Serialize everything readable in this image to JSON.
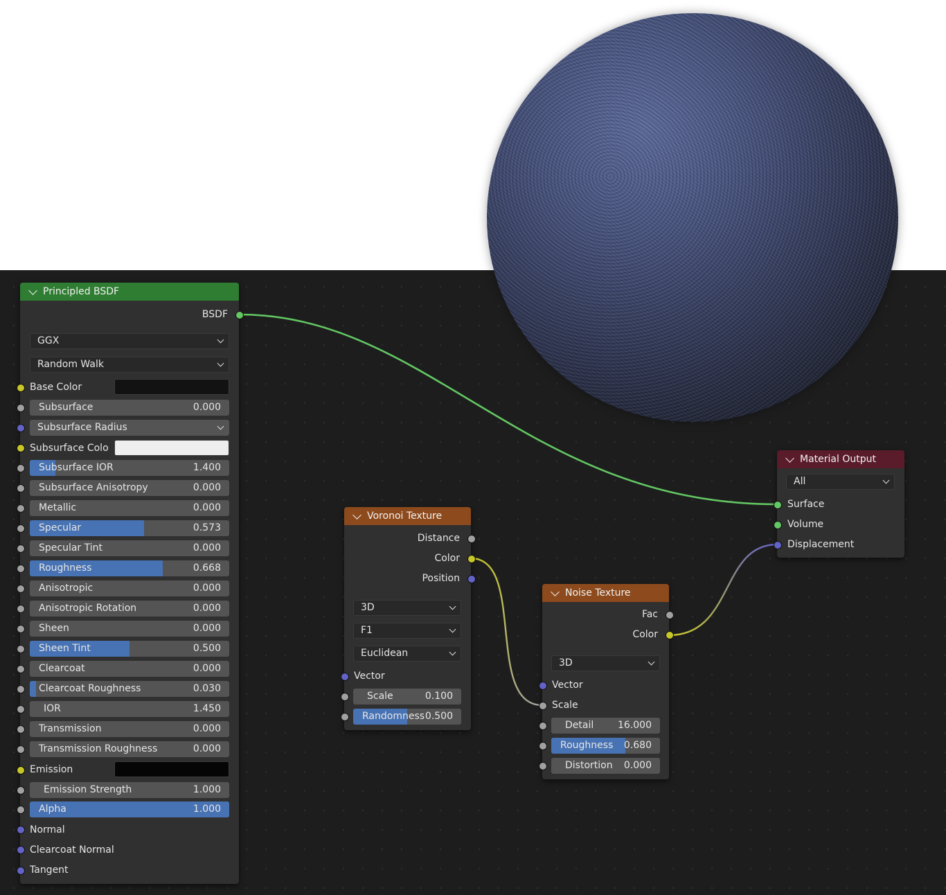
{
  "principled": {
    "title": "Principled BSDF",
    "header_color": "#2f7d32",
    "output": "BSDF",
    "distribution": "GGX",
    "subsurface_method": "Random Walk",
    "base_color": {
      "label": "Base Color",
      "swatch": "#121212"
    },
    "subsurface": {
      "label": "Subsurface",
      "value": "0.000",
      "fill": 0
    },
    "subsurface_radius": "Subsurface Radius",
    "subsurface_color": {
      "label": "Subsurface Colo",
      "swatch": "#eeeeee"
    },
    "subsurface_ior": {
      "label": "Subsurface IOR",
      "value": "1.400",
      "fill": 0.13
    },
    "subsurface_anisotropy": {
      "label": "Subsurface Anisotropy",
      "value": "0.000",
      "fill": 0
    },
    "metallic": {
      "label": "Metallic",
      "value": "0.000",
      "fill": 0
    },
    "specular": {
      "label": "Specular",
      "value": "0.573",
      "fill": 0.573
    },
    "specular_tint": {
      "label": "Specular Tint",
      "value": "0.000",
      "fill": 0
    },
    "roughness": {
      "label": "Roughness",
      "value": "0.668",
      "fill": 0.668
    },
    "anisotropic": {
      "label": "Anisotropic",
      "value": "0.000",
      "fill": 0
    },
    "anisotropic_rotation": {
      "label": "Anisotropic Rotation",
      "value": "0.000",
      "fill": 0
    },
    "sheen": {
      "label": "Sheen",
      "value": "0.000",
      "fill": 0
    },
    "sheen_tint": {
      "label": "Sheen Tint",
      "value": "0.500",
      "fill": 0.5
    },
    "clearcoat": {
      "label": "Clearcoat",
      "value": "0.000",
      "fill": 0
    },
    "clearcoat_roughness": {
      "label": "Clearcoat Roughness",
      "value": "0.030",
      "fill": 0.03
    },
    "ior": {
      "label": "IOR",
      "value": "1.450",
      "fill": 0
    },
    "transmission": {
      "label": "Transmission",
      "value": "0.000",
      "fill": 0
    },
    "transmission_roughness": {
      "label": "Transmission Roughness",
      "value": "0.000",
      "fill": 0
    },
    "emission": {
      "label": "Emission",
      "swatch": "#050505"
    },
    "emission_strength": {
      "label": "Emission Strength",
      "value": "1.000",
      "fill": 0
    },
    "alpha": {
      "label": "Alpha",
      "value": "1.000",
      "fill": 1.0
    },
    "normal": "Normal",
    "clearcoat_normal": "Clearcoat Normal",
    "tangent": "Tangent"
  },
  "voronoi": {
    "title": "Voronoi Texture",
    "header_color": "#8d4a1d",
    "outputs": [
      "Distance",
      "Color",
      "Position"
    ],
    "dimensions": "3D",
    "feature": "F1",
    "metric": "Euclidean",
    "vector": "Vector",
    "scale": {
      "label": "Scale",
      "value": "0.100",
      "fill": 0
    },
    "randomness": {
      "label": "Randomness",
      "value": "0.500",
      "fill": 0.5
    }
  },
  "noise": {
    "title": "Noise Texture",
    "header_color": "#8d4a1d",
    "outputs": [
      "Fac",
      "Color"
    ],
    "dimensions": "3D",
    "vector": "Vector",
    "scale": "Scale",
    "detail": {
      "label": "Detail",
      "value": "16.000",
      "fill": 0
    },
    "roughness": {
      "label": "Roughness",
      "value": "0.680",
      "fill": 0.68
    },
    "distortion": {
      "label": "Distortion",
      "value": "0.000",
      "fill": 0
    }
  },
  "material_output": {
    "title": "Material Output",
    "header_color": "#5a1c2a",
    "target": "All",
    "inputs": [
      "Surface",
      "Volume",
      "Displacement"
    ]
  },
  "colors": {
    "editor_bg": "#1d1d1d",
    "node_bg": "#303030",
    "field_bg": "#545454",
    "field_fill": "#4772b3",
    "link_shader": "#63c763",
    "link_color": "#c7c729",
    "link_float": "#a1a1a1",
    "link_vector": "#6363c7"
  }
}
